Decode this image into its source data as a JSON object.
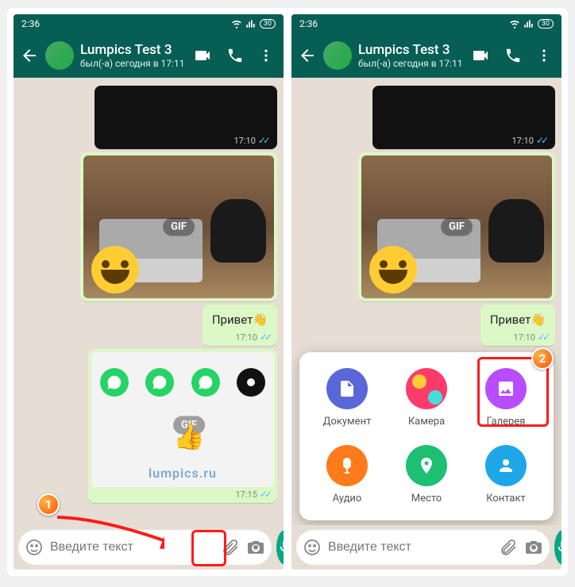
{
  "status": {
    "time": "2:36",
    "battery": "30"
  },
  "header": {
    "name": "Lumpics Test 3",
    "status": "был(-а) сегодня в 17:11"
  },
  "messages": {
    "dark_time": "17:10",
    "gif_label": "GIF",
    "text": "Привет",
    "text_time": "17:10",
    "gif2_time": "17:15",
    "watermark": "lumpics.ru"
  },
  "input": {
    "placeholder": "Введите текст"
  },
  "attach": {
    "document": "Документ",
    "camera": "Камера",
    "gallery": "Галерея",
    "audio": "Аудио",
    "place": "Место",
    "contact": "Контакт"
  },
  "callouts": {
    "one": "1",
    "two": "2"
  }
}
